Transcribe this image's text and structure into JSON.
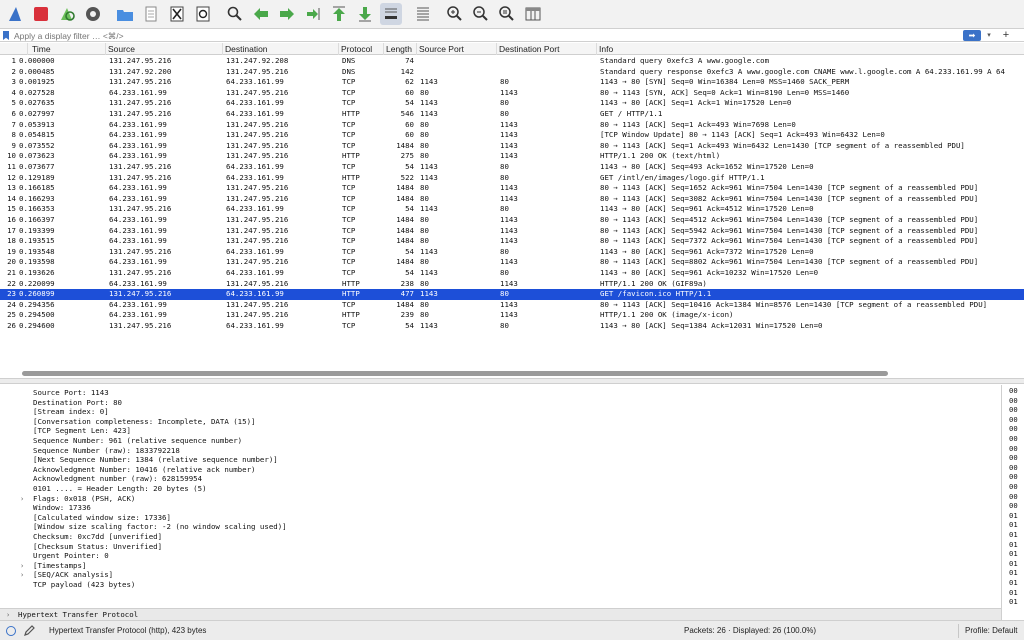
{
  "toolbar": {
    "buttons": [
      "shark-fin-icon",
      "stop-icon",
      "restart-icon",
      "options-gear-icon",
      "open-folder-icon",
      "file-icon",
      "close-file-icon",
      "reload-icon",
      "find-icon",
      "back-arrow-icon",
      "forward-arrow-icon",
      "go-to-packet-icon",
      "first-packet-icon",
      "last-packet-icon",
      "autoscroll-icon",
      "colorize-icon",
      "zoom-in-icon",
      "zoom-out-icon",
      "zoom-normal-icon",
      "resize-columns-icon"
    ],
    "colors": {
      "accent": "#1d4fd8",
      "stop": "#d9303b",
      "green": "#4aa84a"
    }
  },
  "filter": {
    "placeholder": "Apply a display filter … <⌘/>",
    "apply_label": "➡",
    "dropdown_label": "▾",
    "add_label": "+"
  },
  "packet_list": {
    "columns": [
      "Time",
      "Source",
      "Destination",
      "Protocol",
      "Length",
      "Source Port",
      "Destination Port",
      "Info"
    ],
    "rows": [
      {
        "no": "1",
        "time": "0.000000",
        "src": "131.247.95.216",
        "dst": "131.247.92.208",
        "proto": "DNS",
        "len": "74",
        "sport": "",
        "dport": "",
        "info": "Standard query 0xefc3 A www.google.com"
      },
      {
        "no": "2",
        "time": "0.000485",
        "src": "131.247.92.200",
        "dst": "131.247.95.216",
        "proto": "DNS",
        "len": "142",
        "sport": "",
        "dport": "",
        "info": "Standard query response 0xefc3 A www.google.com CNAME www.l.google.com A 64.233.161.99 A 64"
      },
      {
        "no": "3",
        "time": "0.001925",
        "src": "131.247.95.216",
        "dst": "64.233.161.99",
        "proto": "TCP",
        "len": "62",
        "sport": "1143",
        "dport": "80",
        "info": "1143 → 80 [SYN] Seq=0 Win=16384 Len=0 MSS=1460 SACK_PERM"
      },
      {
        "no": "4",
        "time": "0.027528",
        "src": "64.233.161.99",
        "dst": "131.247.95.216",
        "proto": "TCP",
        "len": "60",
        "sport": "80",
        "dport": "1143",
        "info": "80 → 1143 [SYN, ACK] Seq=0 Ack=1 Win=8190 Len=0 MSS=1460"
      },
      {
        "no": "5",
        "time": "0.027635",
        "src": "131.247.95.216",
        "dst": "64.233.161.99",
        "proto": "TCP",
        "len": "54",
        "sport": "1143",
        "dport": "80",
        "info": "1143 → 80 [ACK] Seq=1 Ack=1 Win=17520 Len=0"
      },
      {
        "no": "6",
        "time": "0.027997",
        "src": "131.247.95.216",
        "dst": "64.233.161.99",
        "proto": "HTTP",
        "len": "546",
        "sport": "1143",
        "dport": "80",
        "info": "GET / HTTP/1.1"
      },
      {
        "no": "7",
        "time": "0.053913",
        "src": "64.233.161.99",
        "dst": "131.247.95.216",
        "proto": "TCP",
        "len": "60",
        "sport": "80",
        "dport": "1143",
        "info": "80 → 1143 [ACK] Seq=1 Ack=493 Win=7698 Len=0"
      },
      {
        "no": "8",
        "time": "0.054815",
        "src": "64.233.161.99",
        "dst": "131.247.95.216",
        "proto": "TCP",
        "len": "60",
        "sport": "80",
        "dport": "1143",
        "info": "[TCP Window Update] 80 → 1143 [ACK] Seq=1 Ack=493 Win=6432 Len=0"
      },
      {
        "no": "9",
        "time": "0.073552",
        "src": "64.233.161.99",
        "dst": "131.247.95.216",
        "proto": "TCP",
        "len": "1484",
        "sport": "80",
        "dport": "1143",
        "info": "80 → 1143 [ACK] Seq=1 Ack=493 Win=6432 Len=1430 [TCP segment of a reassembled PDU]"
      },
      {
        "no": "10",
        "time": "0.073623",
        "src": "64.233.161.99",
        "dst": "131.247.95.216",
        "proto": "HTTP",
        "len": "275",
        "sport": "80",
        "dport": "1143",
        "info": "HTTP/1.1 200 OK  (text/html)"
      },
      {
        "no": "11",
        "time": "0.073677",
        "src": "131.247.95.216",
        "dst": "64.233.161.99",
        "proto": "TCP",
        "len": "54",
        "sport": "1143",
        "dport": "80",
        "info": "1143 → 80 [ACK] Seq=493 Ack=1652 Win=17520 Len=0"
      },
      {
        "no": "12",
        "time": "0.129189",
        "src": "131.247.95.216",
        "dst": "64.233.161.99",
        "proto": "HTTP",
        "len": "522",
        "sport": "1143",
        "dport": "80",
        "info": "GET /intl/en/images/logo.gif HTTP/1.1"
      },
      {
        "no": "13",
        "time": "0.166185",
        "src": "64.233.161.99",
        "dst": "131.247.95.216",
        "proto": "TCP",
        "len": "1484",
        "sport": "80",
        "dport": "1143",
        "info": "80 → 1143 [ACK] Seq=1652 Ack=961 Win=7504 Len=1430 [TCP segment of a reassembled PDU]"
      },
      {
        "no": "14",
        "time": "0.166293",
        "src": "64.233.161.99",
        "dst": "131.247.95.216",
        "proto": "TCP",
        "len": "1484",
        "sport": "80",
        "dport": "1143",
        "info": "80 → 1143 [ACK] Seq=3082 Ack=961 Win=7504 Len=1430 [TCP segment of a reassembled PDU]"
      },
      {
        "no": "15",
        "time": "0.166353",
        "src": "131.247.95.216",
        "dst": "64.233.161.99",
        "proto": "TCP",
        "len": "54",
        "sport": "1143",
        "dport": "80",
        "info": "1143 → 80 [ACK] Seq=961 Ack=4512 Win=17520 Len=0"
      },
      {
        "no": "16",
        "time": "0.166397",
        "src": "64.233.161.99",
        "dst": "131.247.95.216",
        "proto": "TCP",
        "len": "1484",
        "sport": "80",
        "dport": "1143",
        "info": "80 → 1143 [ACK] Seq=4512 Ack=961 Win=7504 Len=1430 [TCP segment of a reassembled PDU]"
      },
      {
        "no": "17",
        "time": "0.193399",
        "src": "64.233.161.99",
        "dst": "131.247.95.216",
        "proto": "TCP",
        "len": "1484",
        "sport": "80",
        "dport": "1143",
        "info": "80 → 1143 [ACK] Seq=5942 Ack=961 Win=7504 Len=1430 [TCP segment of a reassembled PDU]"
      },
      {
        "no": "18",
        "time": "0.193515",
        "src": "64.233.161.99",
        "dst": "131.247.95.216",
        "proto": "TCP",
        "len": "1484",
        "sport": "80",
        "dport": "1143",
        "info": "80 → 1143 [ACK] Seq=7372 Ack=961 Win=7504 Len=1430 [TCP segment of a reassembled PDU]"
      },
      {
        "no": "19",
        "time": "0.193548",
        "src": "131.247.95.216",
        "dst": "64.233.161.99",
        "proto": "TCP",
        "len": "54",
        "sport": "1143",
        "dport": "80",
        "info": "1143 → 80 [ACK] Seq=961 Ack=7372 Win=17520 Len=0"
      },
      {
        "no": "20",
        "time": "0.193598",
        "src": "64.233.161.99",
        "dst": "131.247.95.216",
        "proto": "TCP",
        "len": "1484",
        "sport": "80",
        "dport": "1143",
        "info": "80 → 1143 [ACK] Seq=8802 Ack=961 Win=7504 Len=1430 [TCP segment of a reassembled PDU]"
      },
      {
        "no": "21",
        "time": "0.193626",
        "src": "131.247.95.216",
        "dst": "64.233.161.99",
        "proto": "TCP",
        "len": "54",
        "sport": "1143",
        "dport": "80",
        "info": "1143 → 80 [ACK] Seq=961 Ack=10232 Win=17520 Len=0"
      },
      {
        "no": "22",
        "time": "0.220099",
        "src": "64.233.161.99",
        "dst": "131.247.95.216",
        "proto": "HTTP",
        "len": "238",
        "sport": "80",
        "dport": "1143",
        "info": "HTTP/1.1 200 OK  (GIF89a)"
      },
      {
        "no": "23",
        "time": "0.260899",
        "src": "131.247.95.216",
        "dst": "64.233.161.99",
        "proto": "HTTP",
        "len": "477",
        "sport": "1143",
        "dport": "80",
        "info": "GET /favicon.ico HTTP/1.1",
        "selected": true
      },
      {
        "no": "24",
        "time": "0.294356",
        "src": "64.233.161.99",
        "dst": "131.247.95.216",
        "proto": "TCP",
        "len": "1484",
        "sport": "80",
        "dport": "1143",
        "info": "80 → 1143 [ACK] Seq=10416 Ack=1384 Win=8576 Len=1430 [TCP segment of a reassembled PDU]"
      },
      {
        "no": "25",
        "time": "0.294500",
        "src": "64.233.161.99",
        "dst": "131.247.95.216",
        "proto": "HTTP",
        "len": "239",
        "sport": "80",
        "dport": "1143",
        "info": "HTTP/1.1 200 OK  (image/x-icon)"
      },
      {
        "no": "26",
        "time": "0.294600",
        "src": "131.247.95.216",
        "dst": "64.233.161.99",
        "proto": "TCP",
        "len": "54",
        "sport": "1143",
        "dport": "80",
        "info": "1143 → 80 [ACK] Seq=1384 Ack=12031 Win=17520 Len=0"
      }
    ]
  },
  "details": {
    "lines": [
      {
        "text": "Source Port: 1143"
      },
      {
        "text": "Destination Port: 80"
      },
      {
        "text": "[Stream index: 0]"
      },
      {
        "text": "[Conversation completeness: Incomplete, DATA (15)]"
      },
      {
        "text": "[TCP Segment Len: 423]"
      },
      {
        "text": "Sequence Number: 961    (relative sequence number)"
      },
      {
        "text": "Sequence Number (raw): 1833792218"
      },
      {
        "text": "[Next Sequence Number: 1384    (relative sequence number)]"
      },
      {
        "text": "Acknowledgment Number: 10416    (relative ack number)"
      },
      {
        "text": "Acknowledgment number (raw): 628159954"
      },
      {
        "text": "0101 .... = Header Length: 20 bytes (5)"
      },
      {
        "text": "Flags: 0x018 (PSH, ACK)",
        "expand": true
      },
      {
        "text": "Window: 17336"
      },
      {
        "text": "[Calculated window size: 17336]"
      },
      {
        "text": "[Window size scaling factor: -2 (no window scaling used)]"
      },
      {
        "text": "Checksum: 0xc7dd [unverified]"
      },
      {
        "text": "[Checksum Status: Unverified]"
      },
      {
        "text": "Urgent Pointer: 0"
      },
      {
        "text": "[Timestamps]",
        "expand": true
      },
      {
        "text": "[SEQ/ACK analysis]",
        "expand": true
      },
      {
        "text": "TCP payload (423 bytes)"
      }
    ],
    "bottom_item": "Hypertext Transfer Protocol",
    "bottom_arrow": "›"
  },
  "bytes": {
    "lines": [
      "00",
      "00",
      "00",
      "00",
      "00",
      "00",
      "00",
      "00",
      "00",
      "00",
      "00",
      "00",
      "00",
      "01",
      "01",
      "01",
      "01",
      "01",
      "01",
      "01",
      "01",
      "01",
      "01"
    ]
  },
  "status": {
    "left": "Hypertext Transfer Protocol (http), 423 bytes",
    "packets": "Packets: 26 · Displayed: 26 (100.0%)",
    "profile": "Profile: Default"
  }
}
